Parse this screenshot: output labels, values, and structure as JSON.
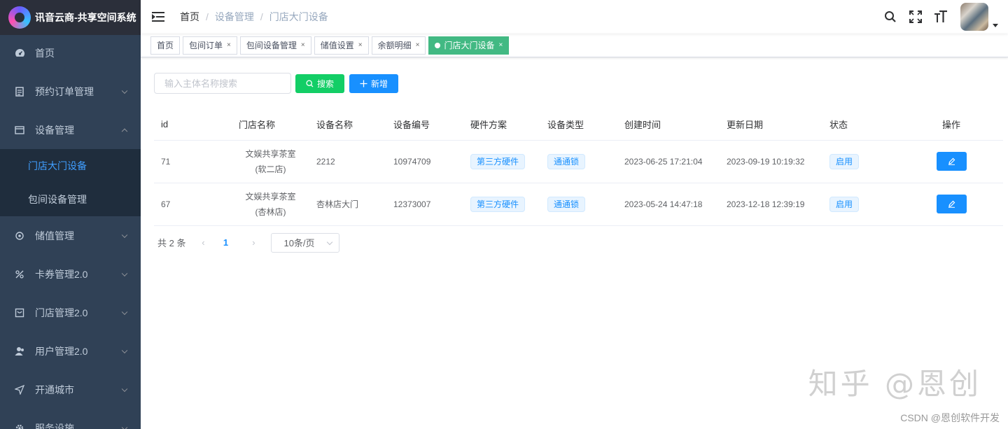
{
  "app": {
    "title": "讯音云商-共享空间系统"
  },
  "sidebar": {
    "items": [
      {
        "label": "首页",
        "icon": "dashboard-icon"
      },
      {
        "label": "预约订单管理",
        "icon": "document-icon"
      },
      {
        "label": "设备管理",
        "icon": "calendar-icon",
        "expanded": true,
        "children": [
          {
            "label": "门店大门设备",
            "active": true
          },
          {
            "label": "包间设备管理",
            "active": false
          }
        ]
      },
      {
        "label": "储值管理",
        "icon": "target-icon"
      },
      {
        "label": "卡券管理2.0",
        "icon": "ticket-icon"
      },
      {
        "label": "门店管理2.0",
        "icon": "store-icon"
      },
      {
        "label": "用户管理2.0",
        "icon": "user-icon"
      },
      {
        "label": "开通城市",
        "icon": "send-icon"
      },
      {
        "label": "服务设施",
        "icon": "gear-icon"
      }
    ]
  },
  "breadcrumb": [
    "首页",
    "设备管理",
    "门店大门设备"
  ],
  "tags": [
    {
      "label": "首页",
      "closable": false,
      "active": false
    },
    {
      "label": "包间订单",
      "closable": true,
      "active": false
    },
    {
      "label": "包间设备管理",
      "closable": true,
      "active": false
    },
    {
      "label": "储值设置",
      "closable": true,
      "active": false
    },
    {
      "label": "余额明细",
      "closable": true,
      "active": false
    },
    {
      "label": "门店大门设备",
      "closable": true,
      "active": true
    }
  ],
  "toolbar": {
    "search_placeholder": "输入主体名称搜索",
    "search_label": "搜索",
    "add_label": "新增"
  },
  "table": {
    "columns": [
      "id",
      "门店名称",
      "设备名称",
      "设备编号",
      "硬件方案",
      "设备类型",
      "创建时间",
      "更新日期",
      "状态",
      "操作"
    ],
    "rows": [
      {
        "id": "71",
        "store_line1": "文娱共享茶室",
        "store_line2": "(软二店)",
        "device_name": "2212",
        "device_no": "10974709",
        "hardware": "第三方硬件",
        "type": "通通锁",
        "created": "2023-06-25 17:21:04",
        "updated": "2023-09-19 10:19:32",
        "status": "启用"
      },
      {
        "id": "67",
        "store_line1": "文娱共享茶室",
        "store_line2": "(杏林店)",
        "device_name": "杏林店大门",
        "device_no": "12373007",
        "hardware": "第三方硬件",
        "type": "通通锁",
        "created": "2023-05-24 14:47:18",
        "updated": "2023-12-18 12:39:19",
        "status": "启用"
      }
    ]
  },
  "pagination": {
    "total": "共 2 条",
    "current": "1",
    "page_size": "10条/页"
  },
  "watermark": "知乎 @恩创",
  "credit": "CSDN @恩创软件开发",
  "colors": {
    "sidebar_bg": "#304156",
    "active_menu": "#409eff",
    "tag_active": "#42b983",
    "primary": "#1890ff",
    "success": "#13ce66"
  }
}
